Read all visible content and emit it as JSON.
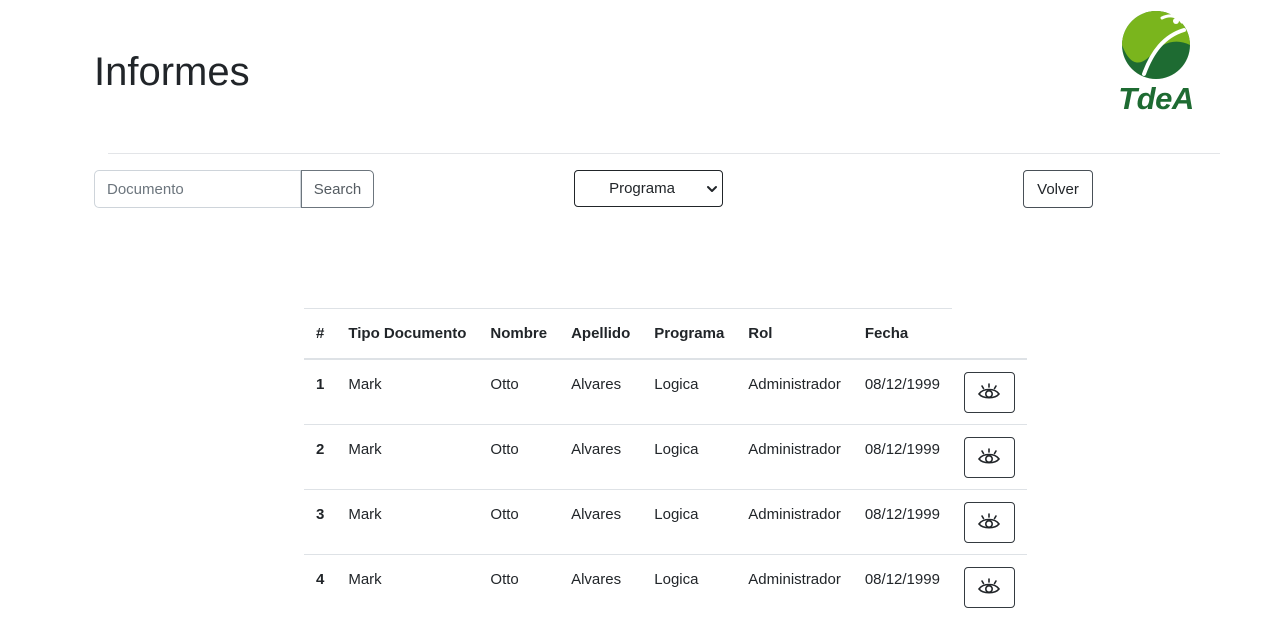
{
  "header": {
    "title": "Informes",
    "logo_text": "TdeA"
  },
  "filters": {
    "document_placeholder": "Documento",
    "search_label": "Search",
    "program_selected": "Programa",
    "back_label": "Volver"
  },
  "table": {
    "columns": [
      "#",
      "Tipo Documento",
      "Nombre",
      "Apellido",
      "Programa",
      "Rol",
      "Fecha"
    ],
    "rows": [
      {
        "num": "1",
        "tipo": "Mark",
        "nombre": "Otto",
        "apellido": "Alvares",
        "programa": "Logica",
        "rol": "Administrador",
        "fecha": "08/12/1999"
      },
      {
        "num": "2",
        "tipo": "Mark",
        "nombre": "Otto",
        "apellido": "Alvares",
        "programa": "Logica",
        "rol": "Administrador",
        "fecha": "08/12/1999"
      },
      {
        "num": "3",
        "tipo": "Mark",
        "nombre": "Otto",
        "apellido": "Alvares",
        "programa": "Logica",
        "rol": "Administrador",
        "fecha": "08/12/1999"
      },
      {
        "num": "4",
        "tipo": "Mark",
        "nombre": "Otto",
        "apellido": "Alvares",
        "programa": "Logica",
        "rol": "Administrador",
        "fecha": "08/12/1999"
      }
    ],
    "row_action_icon": "eye-icon"
  },
  "colors": {
    "logo_green_light": "#7ab51d",
    "logo_green_dark": "#1e6b32",
    "text": "#212529",
    "border": "#dee2e6"
  }
}
